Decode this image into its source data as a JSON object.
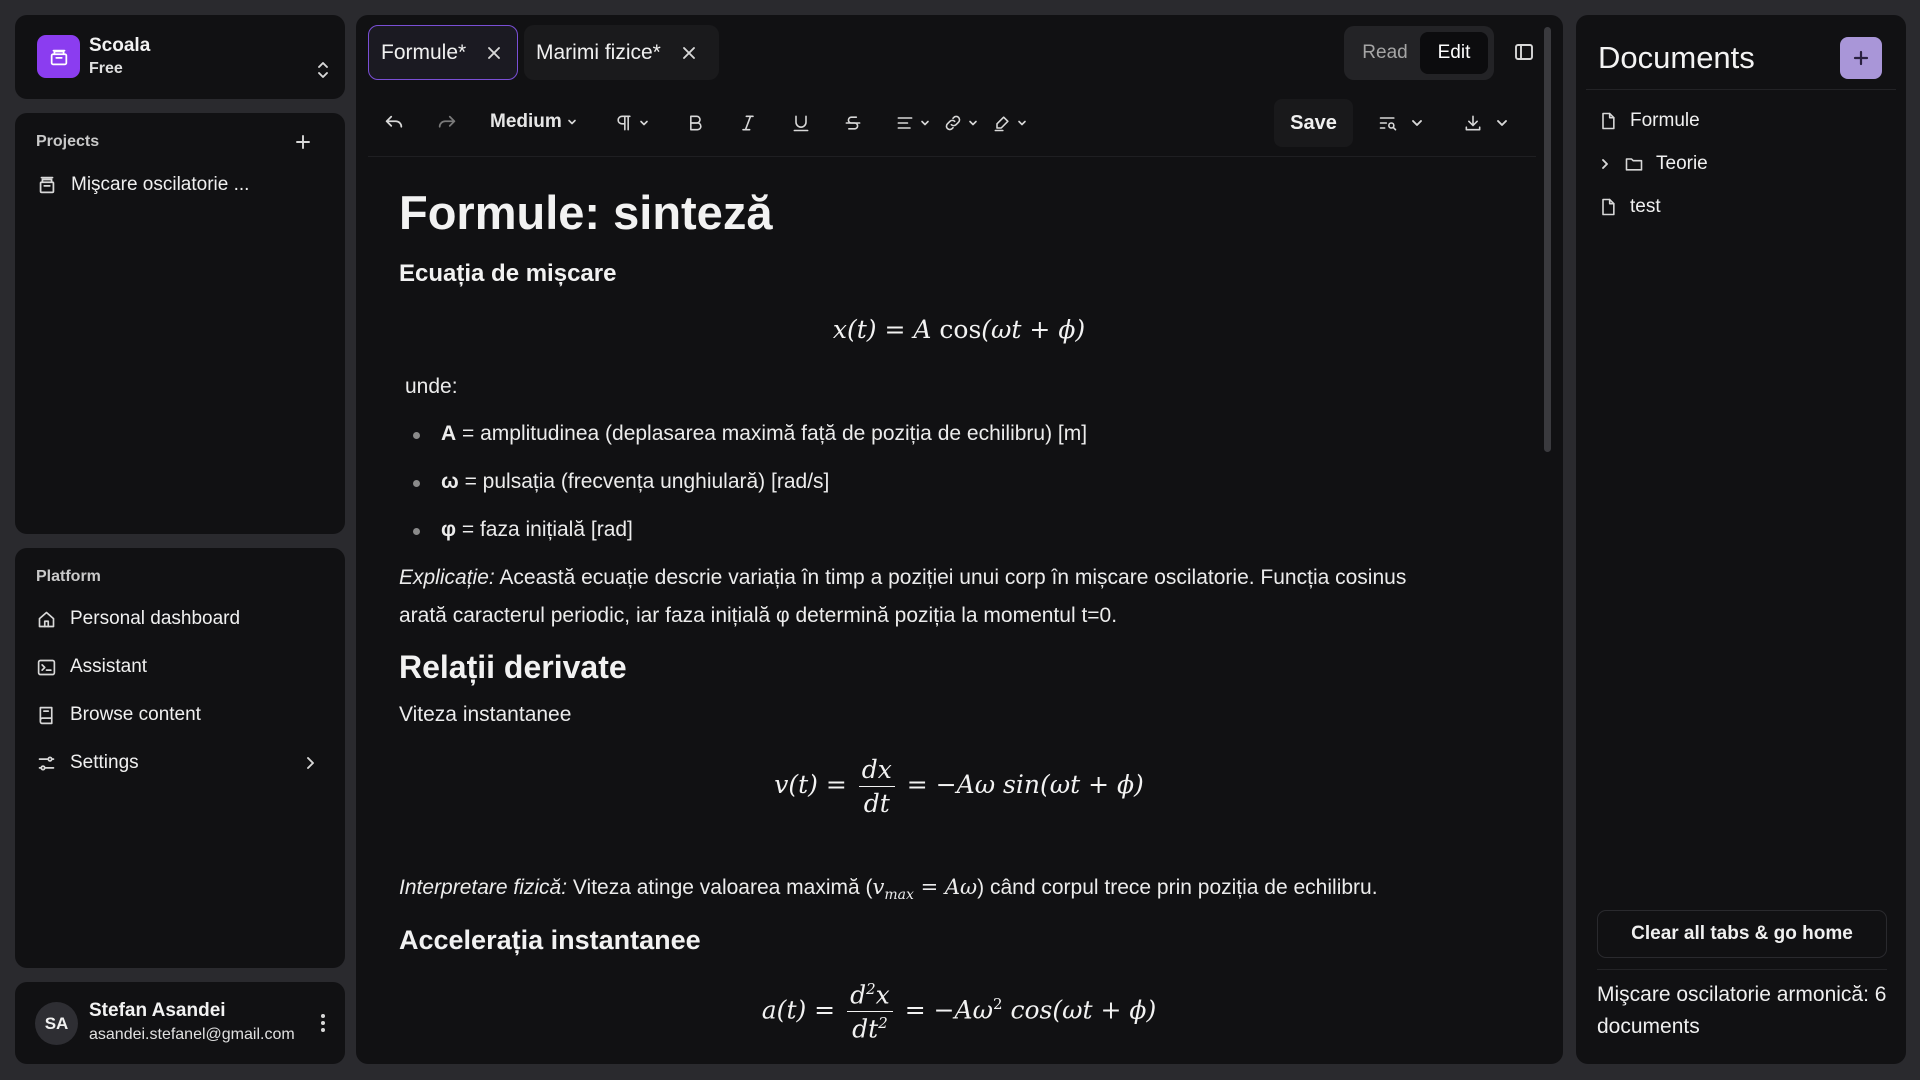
{
  "workspace": {
    "name": "Scoala",
    "plan": "Free"
  },
  "projects": {
    "title": "Projects",
    "items": [
      {
        "label": "Mişcare oscilatorie ..."
      }
    ]
  },
  "platform": {
    "title": "Platform",
    "items": [
      {
        "label": "Personal dashboard",
        "icon": "home-icon"
      },
      {
        "label": "Assistant",
        "icon": "terminal-icon"
      },
      {
        "label": "Browse content",
        "icon": "book-icon"
      },
      {
        "label": "Settings",
        "icon": "settings-icon"
      }
    ]
  },
  "user": {
    "initials": "SA",
    "name": "Stefan Asandei",
    "email": "asandei.stefanel@gmail.com"
  },
  "tabs": [
    {
      "label": "Formule*",
      "active": true
    },
    {
      "label": "Marimi fizice*",
      "active": false
    }
  ],
  "mode": {
    "read": "Read",
    "edit": "Edit",
    "selected": "Edit"
  },
  "toolbar": {
    "font_weight": "Medium",
    "save_label": "Save"
  },
  "document": {
    "title": "Formule: sinteză",
    "s1_heading": "Ecuația de mișcare",
    "eq1": {
      "lhs": "x(t)",
      "eq": "=",
      "rhs_amp": "A",
      "rhs_fn": "cos",
      "rhs_arg": "(ωt + ϕ)"
    },
    "where_label": "unde:",
    "bullets": [
      {
        "symbol": "A",
        "text": " = amplitudinea (deplasarea maximă față de poziția de echilibru) [m]"
      },
      {
        "symbol": "ω",
        "text": " = pulsația (frecvența unghiulară) [rad/s]"
      },
      {
        "symbol": "φ",
        "text": " = faza inițială [rad]"
      }
    ],
    "expl_label": "Explicație:",
    "expl_line1": " Această ecuație descrie variația în timp a poziției unui corp în mișcare oscilatorie. Funcția cosinus",
    "expl_line2": "arată caracterul periodic, iar faza inițială φ determină poziția la momentul t=0.",
    "s2_heading": "Relații derivate",
    "velocity_label": "Viteza instantanee",
    "eq2": {
      "lhs": "v(t) =",
      "num": "dx",
      "den": "dt",
      "rhs": "= −Aω sin(ωt + ϕ)"
    },
    "interp_label": "Interpretare fizică:",
    "interp_before": " Viteza atinge valoarea maximă (",
    "interp_v": "v",
    "interp_sub": "max",
    "interp_math": " = Aω",
    "interp_after": ") când corpul trece prin poziția de echilibru.",
    "s3_heading": "Accelerația instantanee",
    "eq3": {
      "lhs": "a(t) =",
      "num_d": "d",
      "num_sup": "2",
      "num_x": "x",
      "den_dt": "dt",
      "den_sup": "2",
      "rhs_a": "= −Aω",
      "rhs_sup": "2",
      "rhs_b": " cos(ωt + ϕ)"
    }
  },
  "documents_panel": {
    "title": "Documents",
    "tree": [
      {
        "label": "Formule",
        "type": "file"
      },
      {
        "label": "Teorie",
        "type": "folder"
      },
      {
        "label": "test",
        "type": "file"
      }
    ],
    "clear_label": "Clear all tabs & go home",
    "summary": "Mişcare oscilatorie armonică: 6 documents"
  },
  "colors": {
    "accent": "#8b3df0",
    "background": "#111113",
    "tab_border": "#7a4fd6",
    "add_button": "#a996d8"
  }
}
